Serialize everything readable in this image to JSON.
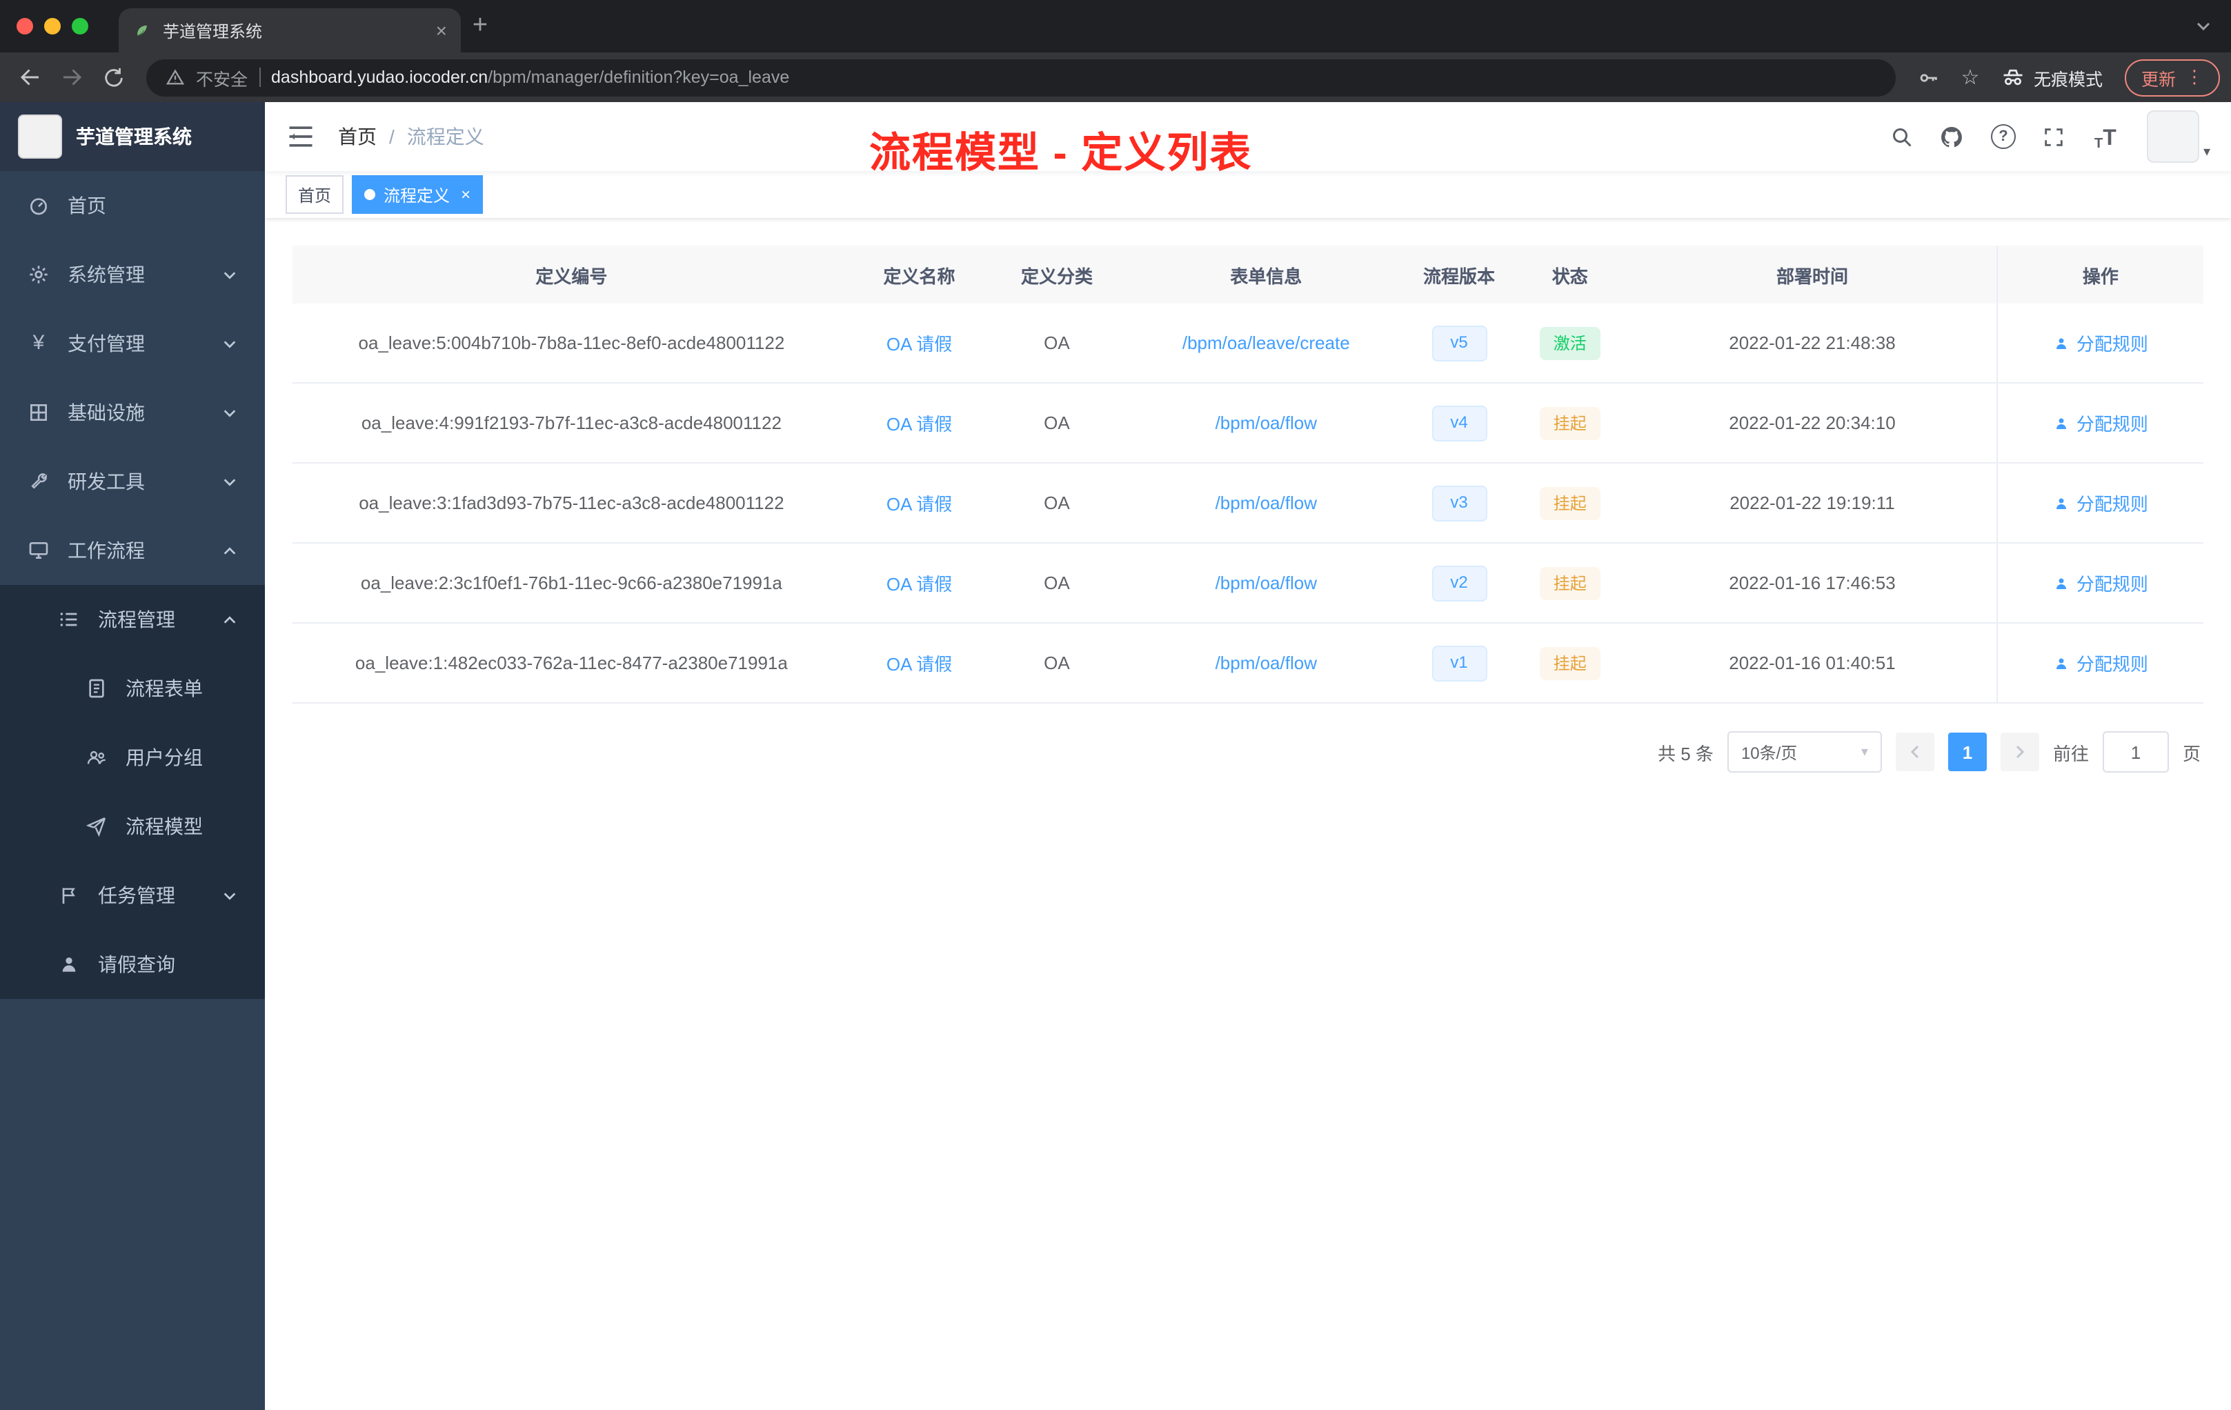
{
  "colors": {
    "accent": "#409eff",
    "success_text": "#12ce66",
    "warning_text": "#e6a23c",
    "annotation_red": "#fd2b20",
    "sidebar_bg": "#304156",
    "submenu_bg": "#1f2d3d"
  },
  "browser": {
    "tab_title": "芋道管理系统",
    "security_label": "不安全",
    "url_host": "dashboard.yudao.iocoder.cn",
    "url_path": "/bpm/manager/definition?key=oa_leave",
    "incognito_label": "无痕模式",
    "update_label": "更新"
  },
  "icons": {
    "close": "×",
    "new_tab": "+",
    "menu_dots": "⋮",
    "caret_down": "▾",
    "question": "?",
    "star": "☆",
    "yen": "¥",
    "tsize_big": "T",
    "tsize_small": "T"
  },
  "sidebar": {
    "app_title": "芋道管理系统",
    "items": [
      {
        "label": "首页"
      },
      {
        "label": "系统管理"
      },
      {
        "label": "支付管理"
      },
      {
        "label": "基础设施"
      },
      {
        "label": "研发工具"
      },
      {
        "label": "工作流程"
      },
      {
        "label": "流程管理"
      },
      {
        "label": "流程表单"
      },
      {
        "label": "用户分组"
      },
      {
        "label": "流程模型"
      },
      {
        "label": "任务管理"
      },
      {
        "label": "请假查询"
      }
    ]
  },
  "navbar": {
    "breadcrumb_home": "首页",
    "breadcrumb_sep": "/",
    "breadcrumb_current": "流程定义"
  },
  "annotation": {
    "text": "流程模型 - 定义列表"
  },
  "tags_view": {
    "tags": [
      {
        "label": "首页"
      },
      {
        "label": "流程定义"
      }
    ]
  },
  "table": {
    "columns": [
      "定义编号",
      "定义名称",
      "定义分类",
      "表单信息",
      "流程版本",
      "状态",
      "部署时间",
      "操作"
    ],
    "action_label": "分配规则",
    "rows": [
      {
        "id": "oa_leave:5:004b710b-7b8a-11ec-8ef0-acde48001122",
        "name": "OA 请假",
        "category": "OA",
        "form": "/bpm/oa/leave/create",
        "version": "v5",
        "status": "激活",
        "time": "2022-01-22 21:48:38"
      },
      {
        "id": "oa_leave:4:991f2193-7b7f-11ec-a3c8-acde48001122",
        "name": "OA 请假",
        "category": "OA",
        "form": "/bpm/oa/flow",
        "version": "v4",
        "status": "挂起",
        "time": "2022-01-22 20:34:10"
      },
      {
        "id": "oa_leave:3:1fad3d93-7b75-11ec-a3c8-acde48001122",
        "name": "OA 请假",
        "category": "OA",
        "form": "/bpm/oa/flow",
        "version": "v3",
        "status": "挂起",
        "time": "2022-01-22 19:19:11"
      },
      {
        "id": "oa_leave:2:3c1f0ef1-76b1-11ec-9c66-a2380e71991a",
        "name": "OA 请假",
        "category": "OA",
        "form": "/bpm/oa/flow",
        "version": "v2",
        "status": "挂起",
        "time": "2022-01-16 17:46:53"
      },
      {
        "id": "oa_leave:1:482ec033-762a-11ec-8477-a2380e71991a",
        "name": "OA 请假",
        "category": "OA",
        "form": "/bpm/oa/flow",
        "version": "v1",
        "status": "挂起",
        "time": "2022-01-16 01:40:51"
      }
    ]
  },
  "pagination": {
    "total": "共 5 条",
    "page_size": "10条/页",
    "current_page": "1",
    "goto_label": "前往",
    "goto_value": "1",
    "page_unit": "页"
  }
}
